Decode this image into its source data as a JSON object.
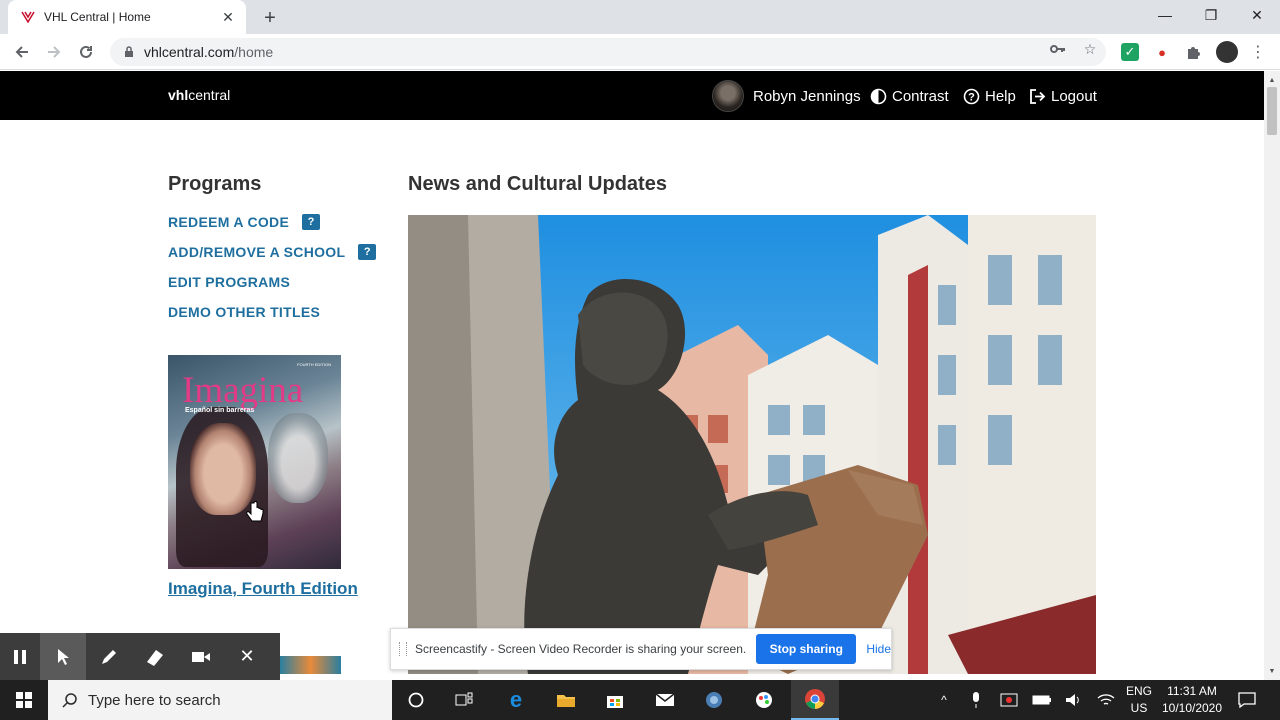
{
  "browser": {
    "tab_title": "VHL Central | Home",
    "new_tab_label": "+",
    "url_host": "vhlcentral.com",
    "url_path": "/home"
  },
  "site": {
    "logo_bold": "vhl",
    "logo_regular": "central",
    "user_name": "Robyn Jennings",
    "contrast_label": "Contrast",
    "help_label": "Help",
    "logout_label": "Logout"
  },
  "programs": {
    "title": "Programs",
    "links": [
      {
        "label": "REDEEM A CODE",
        "help": "?"
      },
      {
        "label": "ADD/REMOVE A SCHOOL",
        "help": "?"
      },
      {
        "label": "EDIT PROGRAMS"
      },
      {
        "label": "DEMO OTHER TITLES"
      }
    ],
    "book": {
      "cover_title": "Imagina",
      "cover_edition": "FOURTH EDITION",
      "cover_subtitle": "Español sin barreras",
      "title": "Imagina, Fourth Edition"
    }
  },
  "news": {
    "title": "News and Cultural Updates"
  },
  "screencastify": {
    "share_message": "Screencastify - Screen Video Recorder is sharing your screen.",
    "stop_label": "Stop sharing",
    "hide_label": "Hide"
  },
  "taskbar": {
    "search_placeholder": "Type here to search",
    "language_line1": "ENG",
    "language_line2": "US",
    "time": "11:31 AM",
    "date": "10/10/2020"
  },
  "colors": {
    "link_blue": "#1e6f9f",
    "header_black": "#000000",
    "share_blue": "#1a73e8"
  }
}
